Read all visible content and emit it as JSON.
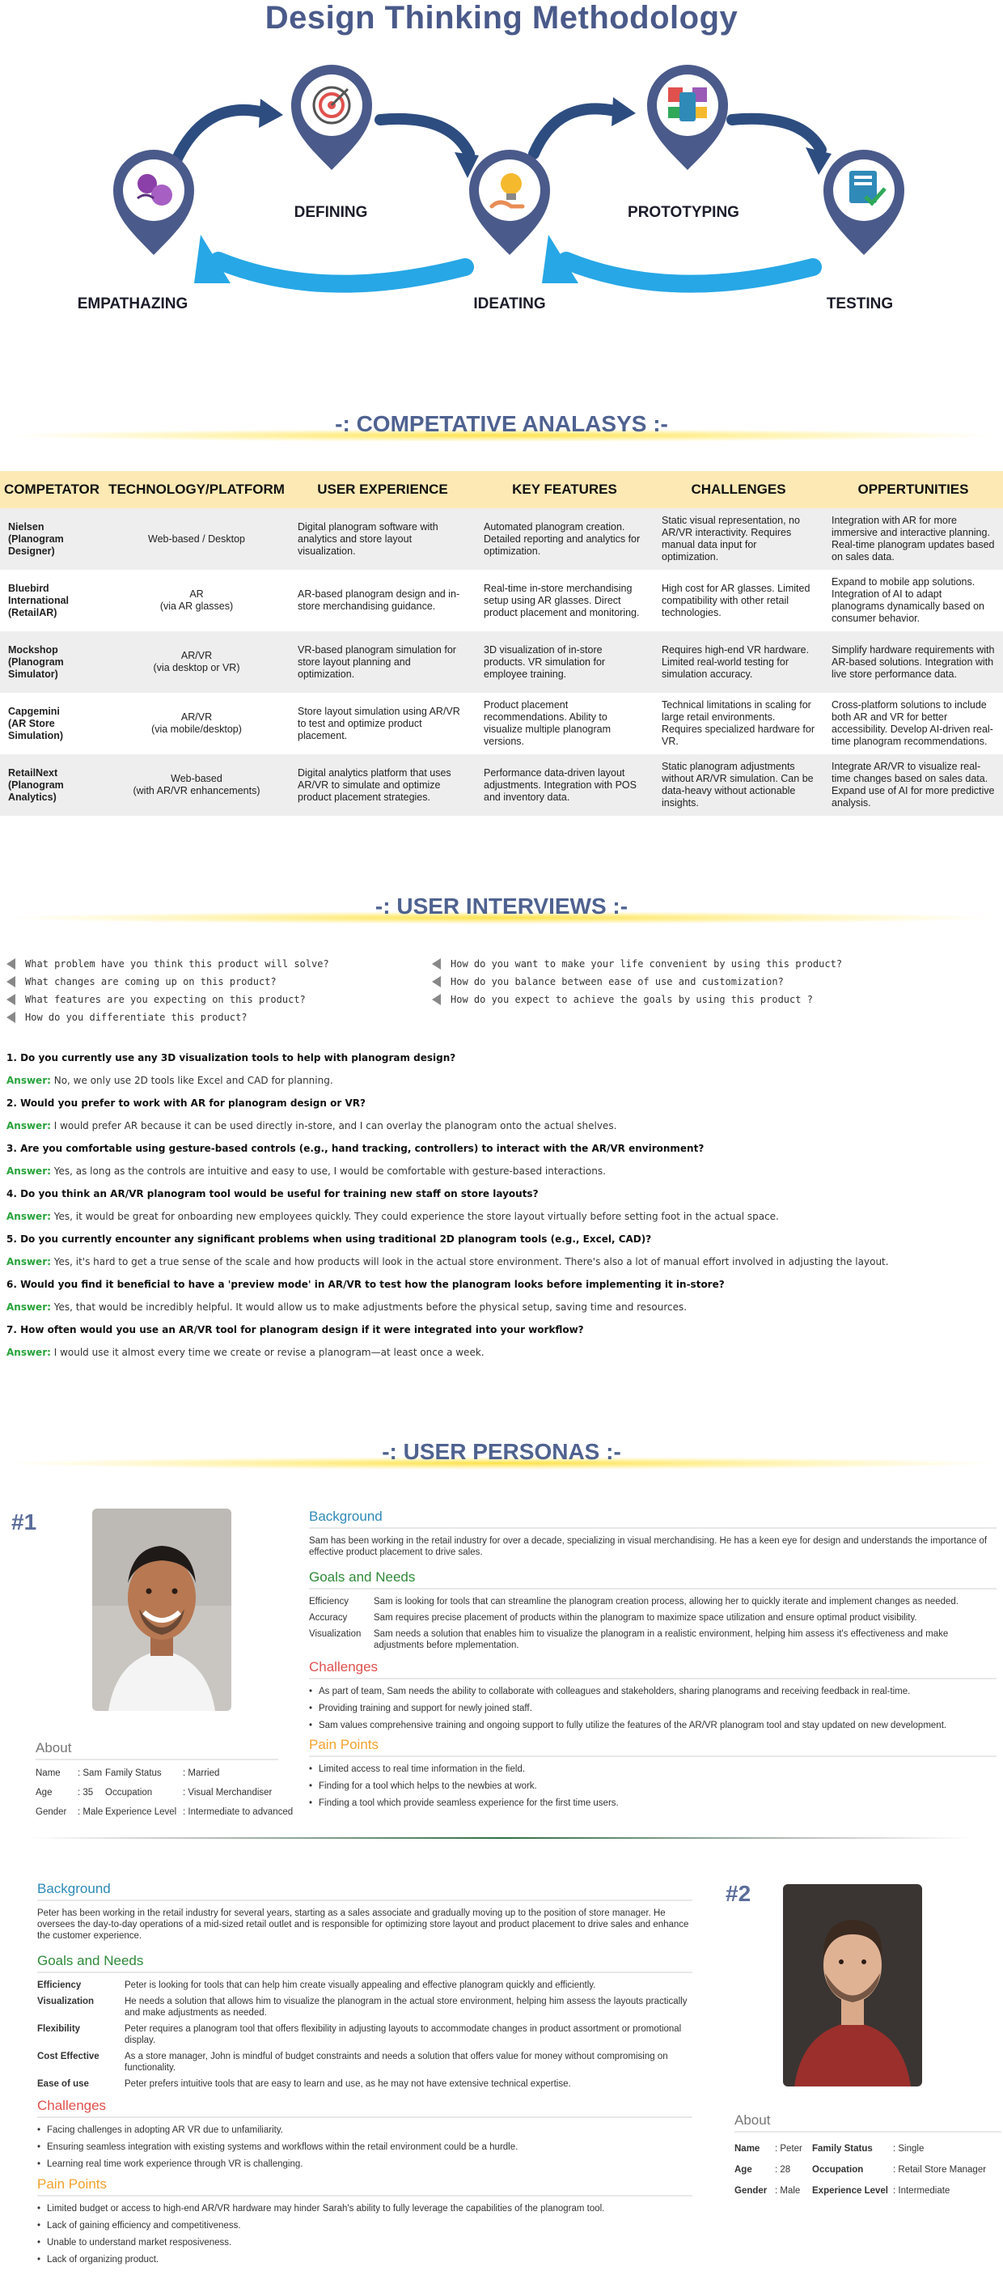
{
  "design_thinking": {
    "title": "Design Thinking Methodology",
    "stages": {
      "empathazing": "EMPATHAZING",
      "defining": "DEFINING",
      "ideating": "IDEATING",
      "prototyping": "PROTOTYPING",
      "testing": "TESTING"
    },
    "colors": {
      "pin": "#4a5a8a",
      "arrow_dark": "#2d4d80",
      "arrow_light": "#27a7e6"
    }
  },
  "competitive": {
    "heading": "-: COMPETATIVE ANALASYS :-",
    "columns": [
      "COMPETATOR",
      "TECHNOLOGY/PLATFORM",
      "USER EXPERIENCE",
      "KEY FEATURES",
      "CHALLENGES",
      "OPPERTUNITIES"
    ],
    "rows": [
      {
        "competitor": "Nielsen\n(Planogram Designer)",
        "tech": "Web-based / Desktop",
        "ux": "Digital planogram software with analytics and store layout visualization.",
        "features": "Automated planogram creation. Detailed reporting and analytics for optimization.",
        "challenges": "Static visual representation, no AR/VR interactivity. Requires manual data input for optimization.",
        "opportunities": "Integration with AR for more immersive and interactive planning. Real-time planogram updates based on sales data."
      },
      {
        "competitor": "Bluebird International\n(RetailAR)",
        "tech": "AR\n(via AR glasses)",
        "ux": "AR-based planogram design and in-store merchandising guidance.",
        "features": "Real-time in-store merchandising setup using AR glasses. Direct product placement and monitoring.",
        "challenges": "High cost for AR glasses. Limited compatibility with other retail technologies.",
        "opportunities": "Expand to mobile app solutions. Integration of AI to adapt planograms dynamically based on consumer behavior."
      },
      {
        "competitor": "Mockshop\n(Planogram Simulator)",
        "tech": "AR/VR\n(via desktop or VR)",
        "ux": "VR-based planogram simulation for store layout planning and optimization.",
        "features": "3D visualization of in-store products. VR simulation for employee training.",
        "challenges": "Requires high-end VR hardware. Limited real-world testing for simulation accuracy.",
        "opportunities": "Simplify hardware requirements with AR-based solutions. Integration with live store performance data."
      },
      {
        "competitor": "Capgemini\n(AR Store Simulation)",
        "tech": "AR/VR\n(via mobile/desktop)",
        "ux": "Store layout simulation using AR/VR to test and optimize product placement.",
        "features": "Product placement recommendations. Ability to visualize multiple planogram versions.",
        "challenges": "Technical limitations in scaling for large retail environments. Requires specialized hardware for VR.",
        "opportunities": " Cross-platform solutions to include both AR and VR for better accessibility. Develop AI-driven real-time planogram recommendations."
      },
      {
        "competitor": "RetailNext\n(Planogram Analytics)",
        "tech": "Web-based\n(with AR/VR enhancements)",
        "ux": "Digital analytics platform that uses AR/VR to simulate and optimize product placement strategies.",
        "features": "Performance data-driven layout adjustments. Integration with POS and inventory data.",
        "challenges": "Static planogram adjustments without AR/VR simulation. Can be data-heavy without actionable insights.",
        "opportunities": "Integrate AR/VR to visualize real-time changes based on sales data. Expand use of AI for more predictive analysis."
      }
    ]
  },
  "interviews": {
    "heading": "-: USER INTERVIEWS :-",
    "prompts_left": [
      "What problem have you think this product will solve?",
      "What changes are coming up on this product?",
      "What features are you expecting on this product?",
      "How do you differentiate this product?"
    ],
    "prompts_right": [
      "How do you want to make your life convenient by using this product?",
      "How do you balance between ease of use and customization?",
      "How do you expect to achieve the goals by using this product ?"
    ],
    "answer_label": "Answer:",
    "qa": [
      {
        "q": "1. Do you currently use any 3D visualization tools to help with planogram design?",
        "a": " No, we only use 2D tools like Excel and CAD for planning."
      },
      {
        "q": "2. Would you prefer to work with AR for planogram design or VR?",
        "a": " I would prefer AR because it can be used directly in-store, and I can overlay the planogram onto the actual shelves."
      },
      {
        "q": "3. Are you comfortable using gesture-based controls (e.g., hand tracking, controllers) to interact with the AR/VR environment?",
        "a": " Yes, as long as the controls are intuitive and easy to use, I would be comfortable with gesture-based interactions."
      },
      {
        "q": "4. Do you think an AR/VR planogram tool would be useful for training new staff on store layouts?",
        "a": " Yes, it would be great for onboarding new employees quickly. They could experience the store layout virtually before setting foot in the actual space."
      },
      {
        "q": "5. Do you currently encounter any significant problems when using traditional 2D planogram tools (e.g., Excel, CAD)?",
        "a": " Yes, it's hard to get a true sense of the scale and how products will look in the actual store environment. There's also a lot of manual effort involved in adjusting the layout."
      },
      {
        "q": "6. Would you find it beneficial to have a 'preview mode' in AR/VR to test how the  planogram looks before implementing it in-store?",
        "a": " Yes, that would be incredibly helpful. It would allow us to make adjustments before the physical setup, saving time and resources."
      },
      {
        "q": "7. How often would you use an AR/VR tool for planogram design if it were integrated into your workflow?",
        "a": " I would use it almost every time we create or revise a planogram—at least once a week."
      }
    ]
  },
  "personas": {
    "heading": "-: USER PERSONAS :-",
    "p1": {
      "number": "#1",
      "background_title": "Background",
      "background": "Sam has been working in the retail industry for over a decade, specializing in visual merchandising. He has a keen eye for design and understands the importance of effective product placement to drive sales.",
      "goals_title": "Goals and Needs",
      "goals": [
        {
          "k": "Efficiency",
          "v": "Sam is looking for tools that can streamline the planogram creation process, allowing her to  quickly iterate and implement changes as needed."
        },
        {
          "k": "Accuracy",
          "v": "Sam requires precise placement of products within the planogram to maximize space utilization and ensure optimal product visibility."
        },
        {
          "k": "Visualization",
          "v": "Sam needs a solution that enables him to visualize the planogram in a realistic environment, helping him assess it's effectiveness and make adjustments before mplementation."
        }
      ],
      "challenges_title": "Challenges",
      "challenges": [
        "As part of team, Sam needs the ability to collaborate with colleagues and stakeholders, sharing planograms and receiving feedback in real-time.",
        "Providing training and support for newly joined staff.",
        "Sam values comprehensive training and ongoing support to fully utilize the features of the AR/VR planogram tool and stay updated on new development."
      ],
      "pain_title": "Pain Points",
      "pain": [
        "Limited access to real time information in the field.",
        "Finding for a tool which helps to the newbies at work.",
        "Finding a tool which provide seamless experience for the first time users."
      ],
      "about_title": "About",
      "about": {
        "name_k": "Name",
        "name_v": ": Sam",
        "age_k": "Age",
        "age_v": ": 35",
        "gender_k": "Gender",
        "gender_v": ": Male",
        "family_k": "Family Status",
        "family_v": ": Married",
        "occ_k": "Occupation",
        "occ_v": ": Visual Merchandiser",
        "exp_k": "Experience Level",
        "exp_v": ": Intermediate to advanced"
      }
    },
    "p2": {
      "number": "#2",
      "background_title": "Background",
      "background": "Peter has been working in the retail industry for several years, starting as a sales associate and gradually moving up to the position of store manager. He oversees the day-to-day operations of a mid-sized retail outlet and is responsible for optimizing store layout and product placement to drive sales and enhance the customer experience.",
      "goals_title": "Goals and Needs",
      "goals": [
        {
          "k": "Efficiency",
          "v": "Peter is looking for tools that can help him create visually appealing and effective planogram quickly  and efficiently."
        },
        {
          "k": "Visualization",
          "v": "He needs a solution that allows him to visualize the planogram in the actual store environment, helping him assess the layouts practically and make adjustments as needed."
        },
        {
          "k": "Flexibility",
          "v": "Peter requires a planogram tool that offers flexibility in adjusting layouts to accommodate changes in product assortment or promotional display."
        },
        {
          "k": "Cost Effective",
          "v": "As a store manager, John is mindful of budget constraints and needs a solution that offers value for money without compromising on functionality."
        },
        {
          "k": "Ease of use",
          "v": "Peter prefers intuitive  tools that are easy to learn and use, as he may not have extensive technical expertise."
        }
      ],
      "challenges_title": "Challenges",
      "challenges": [
        "Facing challenges in adopting AR VR due to unfamiliarity.",
        "Ensuring seamless integration with existing systems and workflows within the retail environment could be a hurdle.",
        "Learning real time work experience through VR is challenging."
      ],
      "pain_title": "Pain Points",
      "pain": [
        "Limited budget or access to high-end AR/VR hardware may hinder Sarah's ability to fully leverage the capabilities of the planogram tool.",
        "Lack of gaining efficiency and competitiveness.",
        "Unable to understand market resposiveness.",
        "Lack of organizing product."
      ],
      "about_title": "About",
      "about": {
        "name_k": "Name",
        "name_v": ": Peter",
        "age_k": "Age",
        "age_v": ": 28",
        "gender_k": "Gender",
        "gender_v": ": Male",
        "family_k": "Family Status",
        "family_v": ": Single",
        "occ_k": "Occupation",
        "occ_v": ": Retail Store Manager",
        "exp_k": "Experience Level",
        "exp_v": ": Intermediate"
      }
    }
  }
}
